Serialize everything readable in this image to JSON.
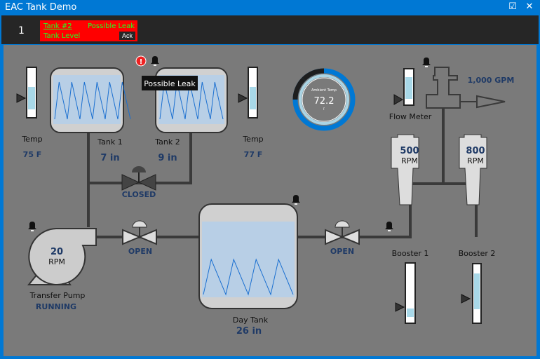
{
  "window": {
    "title": "EAC Tank Demo",
    "icons": [
      "trend-icon",
      "close-icon"
    ]
  },
  "alarm_bar": {
    "count": "1",
    "alarm": {
      "source": "Tank #2",
      "message": "Possible Leak",
      "tag": "Tank Level",
      "ack_label": "Ack",
      "color": "#ff0000",
      "text_color": "#22dd22"
    }
  },
  "tooltip": "Possible Leak",
  "temp_left": {
    "label": "Temp",
    "value": "75 F"
  },
  "temp_right": {
    "label": "Temp",
    "value": "77 F"
  },
  "tank1": {
    "label": "Tank 1",
    "value": "7 in"
  },
  "tank2": {
    "label": "Tank 2",
    "value": "9 in"
  },
  "valve_tanks": {
    "state": "CLOSED"
  },
  "valve_pump": {
    "state": "OPEN"
  },
  "valve_day": {
    "state": "OPEN"
  },
  "gauge": {
    "label": "Ambient Temp",
    "value": "72.2",
    "unit": "F"
  },
  "flow_meter": {
    "label": "Flow Meter",
    "value": "1,000 GPM"
  },
  "booster1": {
    "value": "500",
    "unit": "RPM",
    "label": "Booster 1"
  },
  "booster2": {
    "value": "800",
    "unit": "RPM",
    "label": "Booster 2"
  },
  "pump": {
    "value": "20",
    "unit": "RPM",
    "label": "Transfer Pump",
    "status": "RUNNING"
  },
  "day_tank": {
    "label": "Day Tank",
    "value": "26 in"
  },
  "colors": {
    "accent": "#0078d4",
    "value_text": "#1f3a66",
    "alarm": "#ff0000",
    "background": "#7a7a7a"
  }
}
